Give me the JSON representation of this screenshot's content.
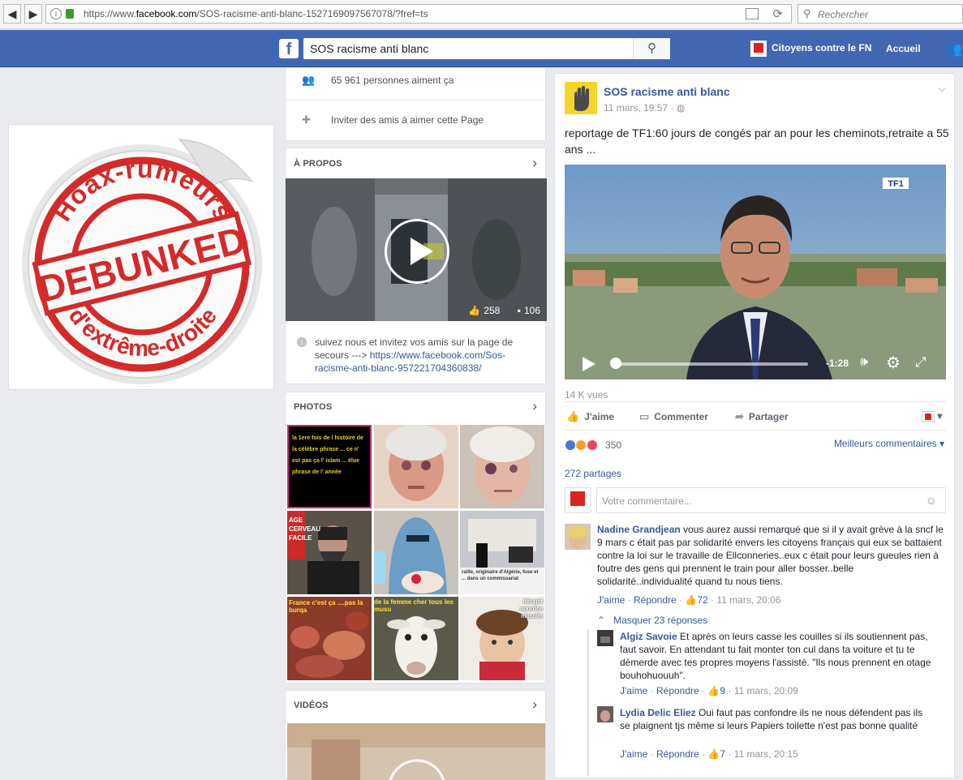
{
  "browser": {
    "url_prefix": "https://www.",
    "url_domain": "facebook.com",
    "url_rest": "/SOS-racisme-anti-blanc-1527169097567078/?fref=ts",
    "search_placeholder": "Rechercher"
  },
  "fb": {
    "search_value": "SOS racisme anti blanc",
    "user_name": "Citoyens contre le FN",
    "home": "Accueil"
  },
  "left_image": {
    "stamp_top": "Hoax-rumeurs",
    "stamp_middle": "DEBUNKED",
    "stamp_bottom": "d'extrême-droite"
  },
  "sidebar": {
    "likes": "65 961 personnes aiment ça",
    "invite": "Inviter des amis à aimer cette Page",
    "about_title": "À PROPOS",
    "video_likes": "258",
    "video_comments": "106",
    "about_text": "suivez nous et invitez vos amis sur la page de secours --->",
    "about_link": "https://www.facebook.com/Sos-racisme-anti-blanc-957221704360838/",
    "photos_title": "PHOTOS",
    "videos_title": "VIDÉOS"
  },
  "photos": [
    {
      "caption": "la 1ere fois de l histoire de la célèbre phrase ... ce n' est pas ça l' islam ... élue phrase de l' année"
    },
    {
      "caption": ""
    },
    {
      "caption": ""
    },
    {
      "caption": "AGE CERVEAU FACILE"
    },
    {
      "caption": ""
    },
    {
      "caption": "raille, originaire d'Algérie, fuse et ... dans un commissariat"
    },
    {
      "caption": "France c'est ça ....pas la burqa"
    },
    {
      "caption": "de la femme cher tous les musu"
    },
    {
      "caption": "décapit nourrice musulm"
    }
  ],
  "post": {
    "page_name": "SOS racisme anti blanc",
    "date": "11 mars, 19:57 ·",
    "text": "reportage de TF1:60 jours de congés par an pour les cheminots,retraite a 55 ans ...",
    "video_time": "-1:28",
    "channel_logo": "TF1",
    "views": "14 K vues",
    "like": "J'aime",
    "comment": "Commenter",
    "share": "Partager",
    "reactions": "350",
    "best_comments": "Meilleurs commentaires",
    "shares": "272 partages",
    "comment_placeholder": "Votre commentaire..."
  },
  "comments": [
    {
      "name": "Nadine Grandjean",
      "text": "vous aurez aussi remarqué que si il y avait grève à la sncf le 9 mars c était pas par solidarité envers les citoyens français qui eux se battaient contre la loi sur le travaille de Ellconneries..eux c était pour leurs gueules rien à foutre des gens qui prennent le train pour aller bosser..belle solidarité..individualité quand tu nous tiens.",
      "like": "J'aime",
      "reply": "Répondre",
      "likes": "72",
      "date": "11 mars, 20:06"
    }
  ],
  "hide_replies": "Masquer 23 réponses",
  "replies": [
    {
      "name": "Algiz Savoie",
      "text": "Et après on leurs casse les couilles si ils soutiennent pas, faut savoir. En attendant tu fait monter ton cul dans ta voiture et tu te démerde avec tes propres moyens l'assisté. \"Ils nous prennent en otage bouhohuouuh\".",
      "like": "J'aime",
      "reply": "Répondre",
      "likes": "9",
      "date": "11 mars, 20:09"
    },
    {
      "name": "Lydia Delic Eliez",
      "text": "Oui faut pas confondre ils ne nous défendent pas ils se plaignent tjs même si leurs Papiers toilette n'est pas bonne qualité",
      "like": "J'aime",
      "reply": "Répondre",
      "likes": "7",
      "date": "11 mars, 20:15"
    }
  ],
  "colors": {
    "fb_blue": "#4267b2",
    "link": "#365899",
    "stamp_red": "#d42a2a"
  }
}
